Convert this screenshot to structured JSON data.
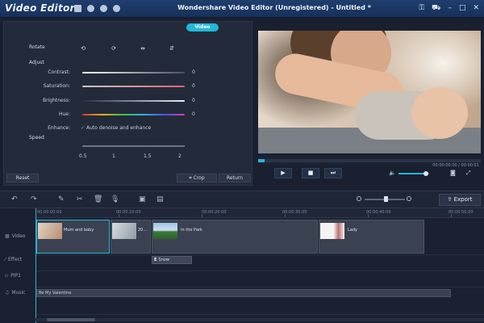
{
  "app": {
    "name": "Video Editor",
    "window_title": "Wondershare Video Editor (Unregistered) - Untitled *"
  },
  "left_panel": {
    "video_tab": "Video",
    "rotate_label": "Rotate",
    "adjust_label": "Adjust",
    "sliders": [
      {
        "label": "Contrast:",
        "value": "0"
      },
      {
        "label": "Saturation:",
        "value": "0"
      },
      {
        "label": "Brightness:",
        "value": "0"
      },
      {
        "label": "Hue:",
        "value": "0"
      }
    ],
    "enhance_label": "Enhance:",
    "enhance_option": "Auto denoise and enhance",
    "speed_label": "Speed",
    "speed_ticks": [
      "0.5",
      "1",
      "1.5",
      "2"
    ],
    "reset_button": "Reset",
    "crop_button": "Crop",
    "return_button": "Return"
  },
  "preview": {
    "time": "00:00:00.00 / 00:00:51",
    "progress": 0.03,
    "volume": 0.9
  },
  "toolbar": {
    "export_label": "Export"
  },
  "timeline": {
    "ruler": [
      "00:00:00:00",
      "00:00:10:00",
      "00:00:20:00",
      "00:00:30:00",
      "00:00:40:00",
      "00:00:50:00"
    ],
    "tracks": {
      "video": "Video",
      "effect": "Effect",
      "pip": "PIP1",
      "music": "Music"
    },
    "clips": [
      {
        "name": "Mum and baby"
      },
      {
        "name": "20..."
      },
      {
        "name": "In the Park"
      },
      {
        "name": "Lady"
      }
    ],
    "effect_clip": "Snow",
    "effect_badge": "E",
    "music_clip": "Be My Valentine"
  },
  "colors": {
    "accent": "#29b3dc",
    "titlebar": "#1f3e6e",
    "panel": "#232b3b"
  }
}
